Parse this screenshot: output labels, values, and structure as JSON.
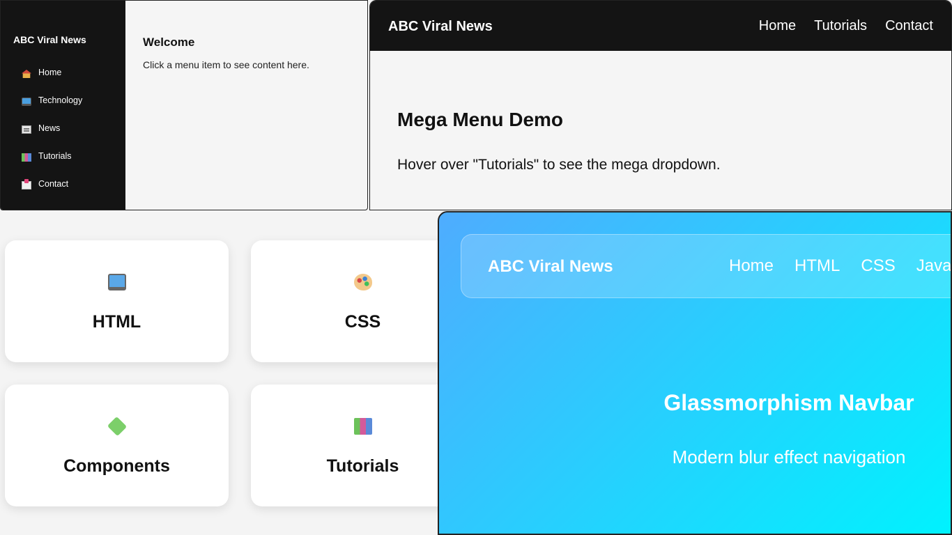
{
  "sidebar_demo": {
    "brand": "ABC Viral News",
    "items": [
      {
        "label": "Home",
        "icon": "house-icon"
      },
      {
        "label": "Technology",
        "icon": "laptop-icon"
      },
      {
        "label": "News",
        "icon": "newspaper-icon"
      },
      {
        "label": "Tutorials",
        "icon": "books-icon"
      },
      {
        "label": "Contact",
        "icon": "mailbox-icon"
      }
    ],
    "content": {
      "title": "Welcome",
      "text": "Click a menu item to see content here."
    }
  },
  "mega_demo": {
    "brand": "ABC Viral News",
    "links": [
      "Home",
      "Tutorials",
      "Contact"
    ],
    "title": "Mega Menu Demo",
    "text": "Hover over \"Tutorials\" to see the mega dropdown."
  },
  "cards": [
    {
      "title": "HTML",
      "icon": "laptop-icon"
    },
    {
      "title": "CSS",
      "icon": "palette-icon"
    },
    {
      "title": "Components",
      "icon": "puzzle-icon"
    },
    {
      "title": "Tutorials",
      "icon": "books-icon"
    }
  ],
  "glass_demo": {
    "brand": "ABC Viral News",
    "links": [
      "Home",
      "HTML",
      "CSS",
      "Java"
    ],
    "title": "Glassmorphism Navbar",
    "text": "Modern blur effect navigation"
  },
  "colors": {
    "dark": "#141414",
    "gradient_start": "#4facfe",
    "gradient_end": "#00f2fe"
  }
}
